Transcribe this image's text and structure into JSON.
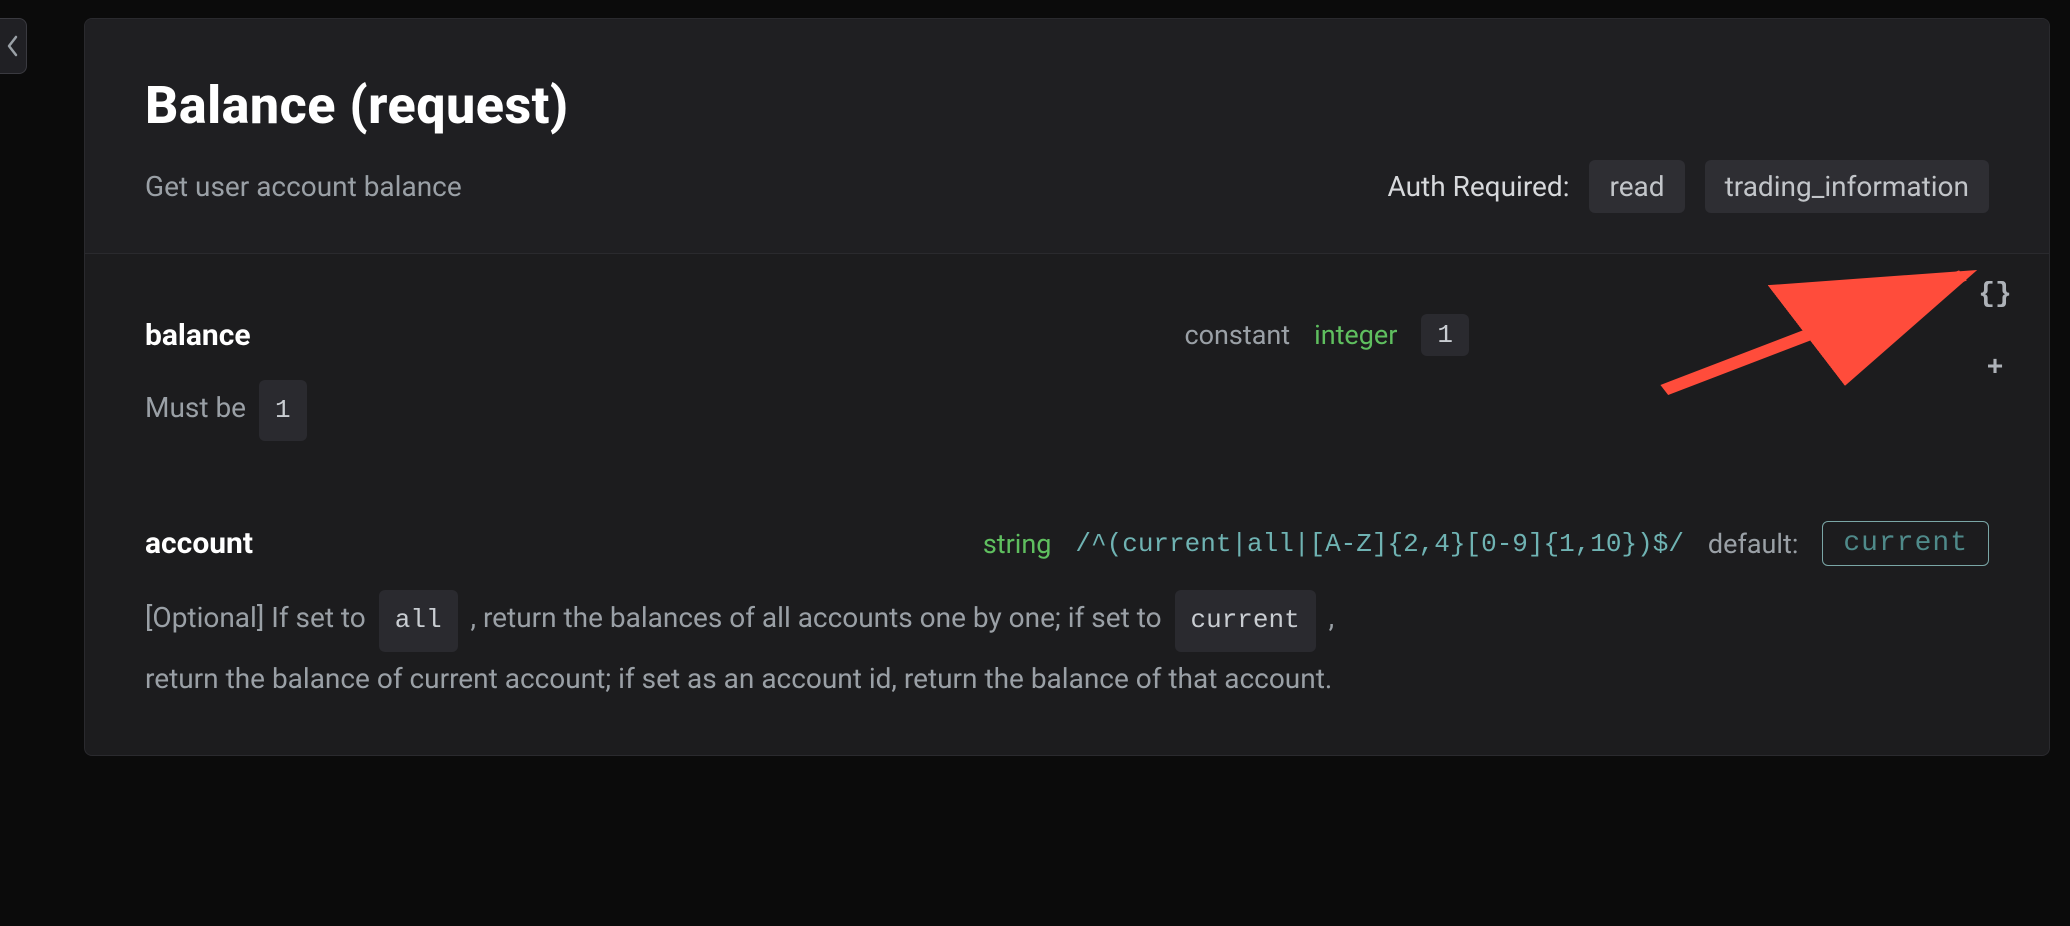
{
  "header": {
    "title": "Balance (request)",
    "subtitle": "Get user account balance",
    "auth_required_label": "Auth Required:",
    "auth_scopes": [
      "read",
      "trading_information"
    ]
  },
  "toolbar": {
    "braces_icon_label": "{}",
    "plus_icon_label": "+"
  },
  "fields": {
    "balance": {
      "name": "balance",
      "constant_label": "constant",
      "type_keyword": "integer",
      "constant_value": "1",
      "desc_prefix": "Must be",
      "desc_chip": "1"
    },
    "account": {
      "name": "account",
      "type_keyword": "string",
      "pattern": "/^(current|all|[A-Z]{2,4}[0-9]{1,10})$/",
      "default_label": "default:",
      "default_value": "current",
      "desc_parts": {
        "p1": "[Optional] If set to",
        "chip_all": "all",
        "p2": ", return the balances of all accounts one by one; if set to",
        "chip_current": "current",
        "p3": ",",
        "p4": "return the balance of current account; if set as an account id, return the balance of that account."
      }
    }
  }
}
